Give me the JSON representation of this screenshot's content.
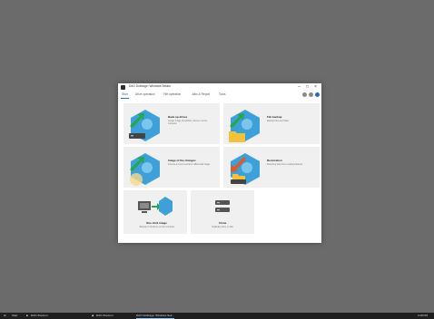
{
  "window": {
    "title": "DAO Dolbrage: Windows Sekkor",
    "controls": {
      "minimize": "–",
      "maximize": "□",
      "close": "×"
    }
  },
  "menubar": {
    "tabs": [
      {
        "label": "Start",
        "active": true
      },
      {
        "label": "Drive operation"
      },
      {
        "label": "File operation"
      },
      {
        "label": "Jobs & Report"
      },
      {
        "label": "Tools"
      }
    ],
    "icons": [
      "settings-icon",
      "help-icon",
      "info-icon"
    ]
  },
  "tiles": [
    {
      "name": "back-up-drives",
      "title": "Back up drives",
      "desc": "Create image of partition, drives or entire computer"
    },
    {
      "name": "file-backup",
      "title": "File backup",
      "desc": "Backup files and folder"
    },
    {
      "name": "image-of-changes",
      "title": "Image of the changes",
      "desc": "Choose an incremental or differential image"
    },
    {
      "name": "restoration",
      "title": "Restoration",
      "desc": "Restoring data from existing backups"
    },
    {
      "name": "one-click-image",
      "title": "One click image",
      "desc": "Backup of all drives on the computer"
    },
    {
      "name": "clone",
      "title": "Clone",
      "desc": "Duplicate drive or disk"
    }
  ],
  "taskbar": {
    "start_label": "Start",
    "items": [
      {
        "label": "DAO ZiveCon"
      },
      {
        "label": "DAO ZiveCon"
      },
      {
        "label": "DAO Dolbrage: Windows Sek..."
      }
    ],
    "clock": "4:28 PM"
  },
  "colors": {
    "desktop": "#6b6b6b",
    "accent": "#2a6cb3",
    "tile_bg": "#f0f0f0",
    "arrow_green": "#29a64a",
    "arrow_orange": "#e05a26",
    "folder_yellow": "#f2c23b",
    "sky_blue": "#3da0d8"
  }
}
